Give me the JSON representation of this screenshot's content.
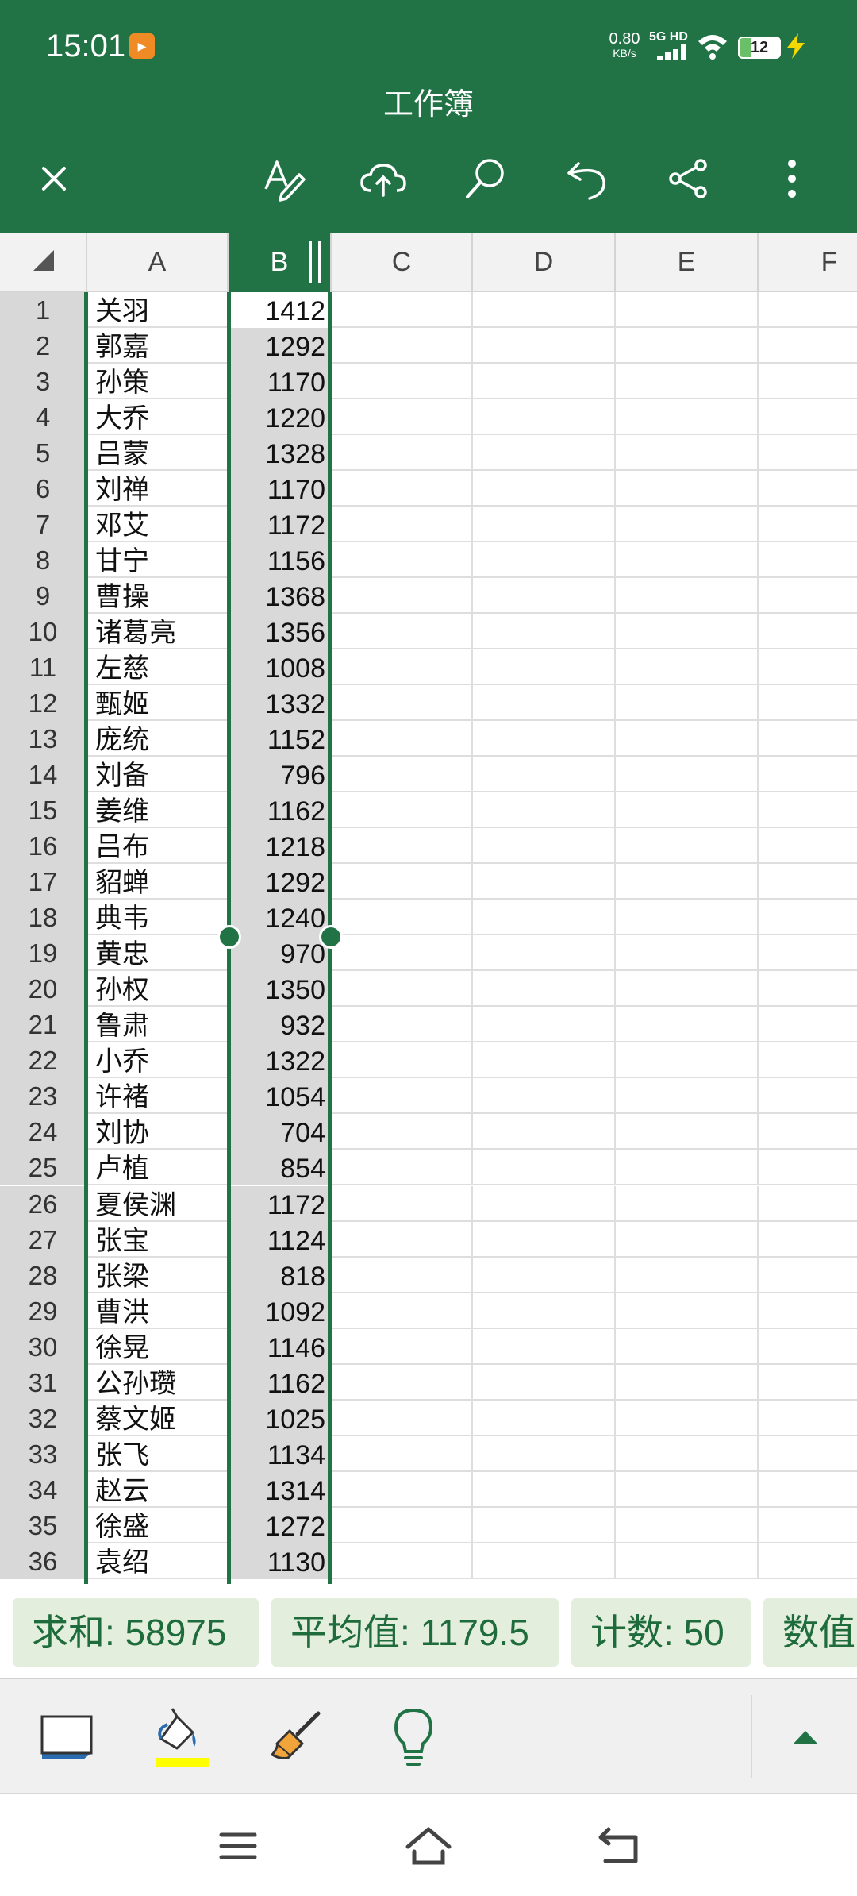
{
  "status_bar": {
    "time": "15:01",
    "app_badge": "▶",
    "net_speed_value": "0.80",
    "net_speed_unit": "KB/s",
    "network": "5G HD",
    "battery": "12"
  },
  "header": {
    "title": "工作簿"
  },
  "toolbar": {
    "icons": [
      "close-icon",
      "edit-icon",
      "cloud-upload-icon",
      "search-icon",
      "undo-icon",
      "share-icon",
      "more-icon"
    ]
  },
  "grid": {
    "columns": [
      "A",
      "B",
      "C",
      "D",
      "E",
      "F"
    ],
    "selected_column": "B",
    "rows": [
      {
        "n": "1",
        "a": "关羽",
        "b": "1412"
      },
      {
        "n": "2",
        "a": "郭嘉",
        "b": "1292"
      },
      {
        "n": "3",
        "a": "孙策",
        "b": "1170"
      },
      {
        "n": "4",
        "a": "大乔",
        "b": "1220"
      },
      {
        "n": "5",
        "a": "吕蒙",
        "b": "1328"
      },
      {
        "n": "6",
        "a": "刘禅",
        "b": "1170"
      },
      {
        "n": "7",
        "a": "邓艾",
        "b": "1172"
      },
      {
        "n": "8",
        "a": "甘宁",
        "b": "1156"
      },
      {
        "n": "9",
        "a": "曹操",
        "b": "1368"
      },
      {
        "n": "10",
        "a": "诸葛亮",
        "b": "1356"
      },
      {
        "n": "11",
        "a": "左慈",
        "b": "1008"
      },
      {
        "n": "12",
        "a": "甄姬",
        "b": "1332"
      },
      {
        "n": "13",
        "a": "庞统",
        "b": "1152"
      },
      {
        "n": "14",
        "a": "刘备",
        "b": "796"
      },
      {
        "n": "15",
        "a": "姜维",
        "b": "1162"
      },
      {
        "n": "16",
        "a": "吕布",
        "b": "1218"
      },
      {
        "n": "17",
        "a": "貂蝉",
        "b": "1292"
      },
      {
        "n": "18",
        "a": "典韦",
        "b": "1240"
      },
      {
        "n": "19",
        "a": "黄忠",
        "b": "970"
      },
      {
        "n": "20",
        "a": "孙权",
        "b": "1350"
      },
      {
        "n": "21",
        "a": "鲁肃",
        "b": "932"
      },
      {
        "n": "22",
        "a": "小乔",
        "b": "1322"
      },
      {
        "n": "23",
        "a": "许褚",
        "b": "1054"
      },
      {
        "n": "24",
        "a": "刘协",
        "b": "704"
      },
      {
        "n": "25",
        "a": "卢植",
        "b": "854"
      },
      {
        "n": "26",
        "a": "夏侯渊",
        "b": "1172"
      },
      {
        "n": "27",
        "a": "张宝",
        "b": "1124"
      },
      {
        "n": "28",
        "a": "张梁",
        "b": "818"
      },
      {
        "n": "29",
        "a": "曹洪",
        "b": "1092"
      },
      {
        "n": "30",
        "a": "徐晃",
        "b": "1146"
      },
      {
        "n": "31",
        "a": "公孙瓒",
        "b": "1162"
      },
      {
        "n": "32",
        "a": "蔡文姬",
        "b": "1025"
      },
      {
        "n": "33",
        "a": "张飞",
        "b": "1134"
      },
      {
        "n": "34",
        "a": "赵云",
        "b": "1314"
      },
      {
        "n": "35",
        "a": "徐盛",
        "b": "1272"
      },
      {
        "n": "36",
        "a": "袁绍",
        "b": "1130"
      }
    ]
  },
  "stats": {
    "sum": "求和: 58975",
    "average": "平均值: 1179.5",
    "count": "计数: 50",
    "numeric_count": "数值"
  },
  "colors": {
    "accent": "#217346",
    "selection_fill": "#d9d9d9",
    "stat_chip": "#e4eedc",
    "highlight": "#ffff00"
  }
}
